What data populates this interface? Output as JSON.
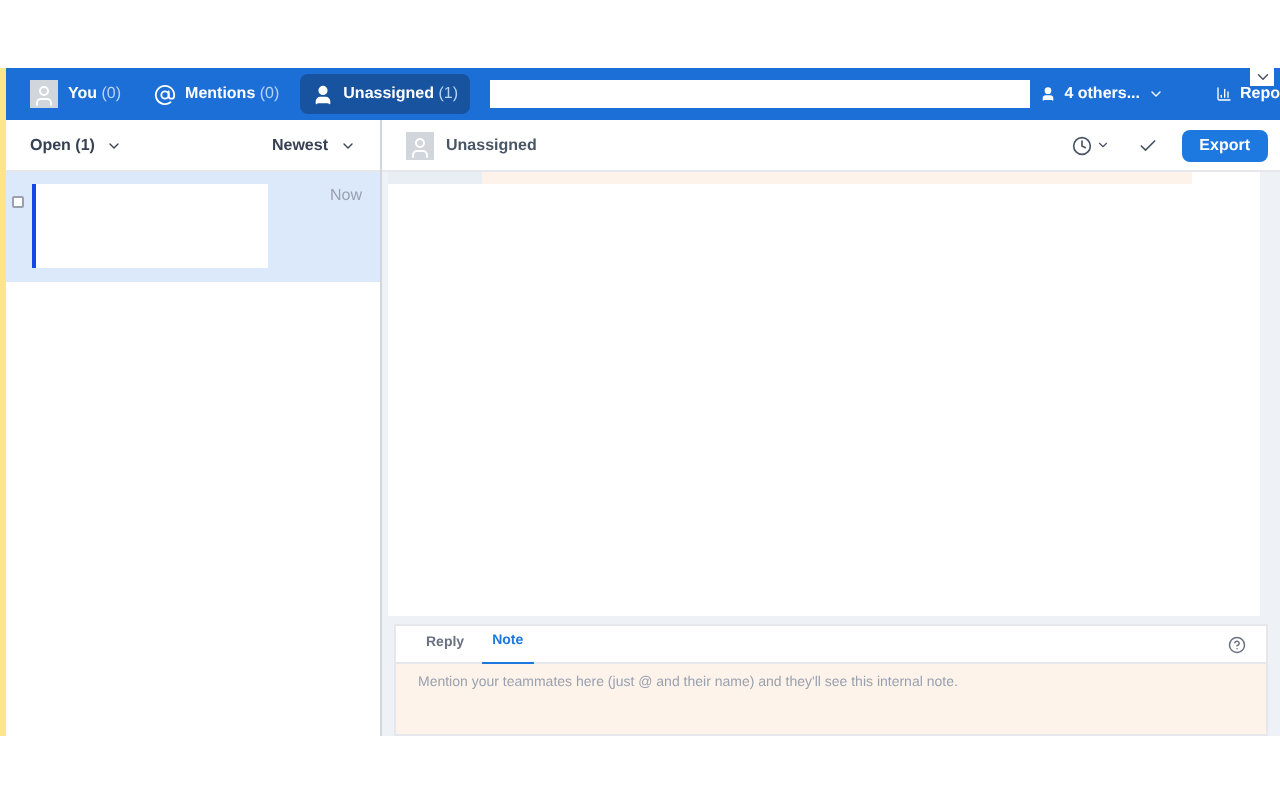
{
  "top_bar": {
    "tabs": [
      {
        "label": "You",
        "count": "(0)",
        "kind": "avatar",
        "selected": false
      },
      {
        "label": "Mentions",
        "count": "(0)",
        "kind": "mentions",
        "selected": false
      },
      {
        "label": "Unassigned",
        "count": "(1)",
        "kind": "person",
        "selected": true
      }
    ],
    "others": "4 others...",
    "reports": "Repo"
  },
  "conversation_list": {
    "filter": "Open (1)",
    "sort": "Newest",
    "items": [
      {
        "time": "Now",
        "selected": true,
        "checked": false
      }
    ]
  },
  "conversation": {
    "assignee": "Unassigned",
    "export": "Export"
  },
  "composer": {
    "tabs": [
      {
        "label": "Reply",
        "selected": false
      },
      {
        "label": "Note",
        "selected": true
      }
    ],
    "placeholder": "Mention your teammates here (just @ and their name) and they'll see this internal note."
  }
}
